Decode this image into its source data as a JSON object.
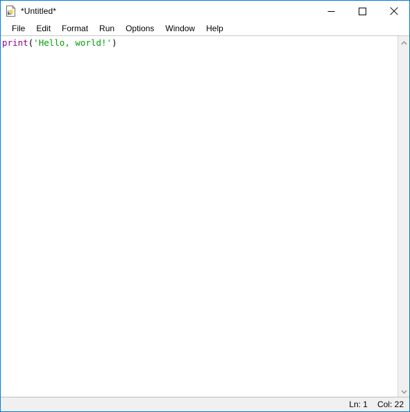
{
  "window": {
    "title": "*Untitled*",
    "icon": "python-file-icon",
    "accent_color": "#0078d7",
    "background": "#ffffff",
    "controls": [
      {
        "name": "minimize",
        "glyph": "minimize-icon"
      },
      {
        "name": "maximize",
        "glyph": "maximize-icon"
      },
      {
        "name": "close",
        "glyph": "close-icon"
      }
    ]
  },
  "menubar": {
    "items": [
      {
        "label": "File"
      },
      {
        "label": "Edit"
      },
      {
        "label": "Format"
      },
      {
        "label": "Run"
      },
      {
        "label": "Options"
      },
      {
        "label": "Window"
      },
      {
        "label": "Help"
      }
    ]
  },
  "editor": {
    "background": "#ffffff",
    "syntax_colors": {
      "builtin": "#900090",
      "string": "#00a000",
      "plain": "#000000"
    },
    "lines": [
      {
        "tokens": [
          {
            "text": "print",
            "type": "builtin"
          },
          {
            "text": "(",
            "type": "plain"
          },
          {
            "text": "'Hello, world!'",
            "type": "string"
          },
          {
            "text": ")",
            "type": "plain"
          }
        ]
      }
    ]
  },
  "scrollbar": {
    "up_arrow": "chevron-up-icon",
    "down_arrow": "chevron-down-icon",
    "track_color": "#f0f0f0"
  },
  "statusbar": {
    "line_label": "Ln: 1",
    "col_label": "Col: 22"
  }
}
